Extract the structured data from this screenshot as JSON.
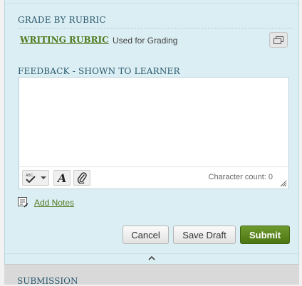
{
  "grade_section": {
    "title": "GRADE BY RUBRIC",
    "rubric_link": "WRITING RUBRIC",
    "rubric_status": "Used for Grading",
    "expand_icon": "expand-window-icon"
  },
  "feedback_section": {
    "title": "FEEDBACK - SHOWN TO LEARNER",
    "text": "",
    "toolbar": {
      "spellcheck_icon": "spellcheck-icon",
      "dropdown_icon": "chevron-down-icon",
      "font_icon": "font-style-icon",
      "attach_icon": "paperclip-icon",
      "character_count": "Character count: 0"
    }
  },
  "notes": {
    "label": "Add Notes",
    "icon": "notes-icon"
  },
  "actions": {
    "cancel": "Cancel",
    "save_draft": "Save Draft",
    "submit": "Submit"
  },
  "submission_section": {
    "title": "SUBMISSION"
  },
  "colors": {
    "panel_bg": "#dbeef3",
    "title": "#2c5a6e",
    "link": "#4f7a1f",
    "submit": "#5a8520"
  }
}
